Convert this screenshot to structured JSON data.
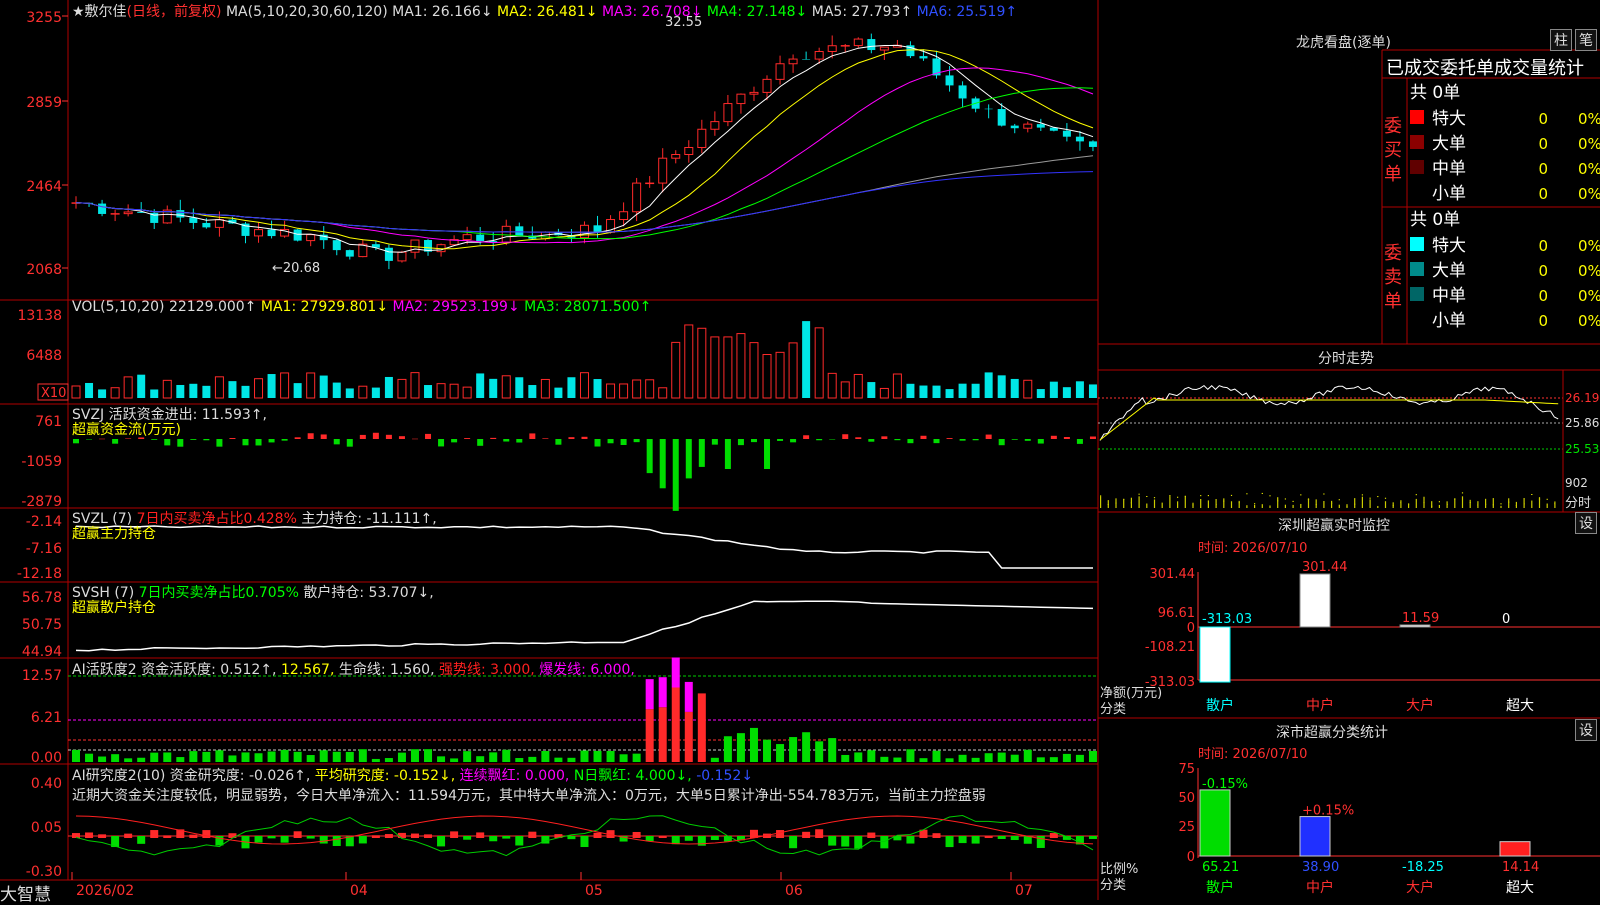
{
  "colors": {
    "up": "#ff2a2a",
    "down": "#00e6e6",
    "green": "#00dd00",
    "ma1": "#ffffff",
    "ma2": "#ffff00",
    "ma3": "#ff00ff",
    "ma4": "#00ff00",
    "ma5": "#9a9a9a",
    "ma6": "#3333ff",
    "grid": "#b00000"
  },
  "kline": {
    "title_stock": "★敷尔佳",
    "title_mode": "(日线，前复权)",
    "title_params": "MA(5,10,20,30,60,120)",
    "ma1": "MA1: 26.166↓",
    "ma2": "MA2: 26.481↓",
    "ma3": "MA3: 26.708↓",
    "ma4": "MA4: 27.148↓",
    "ma5": "MA5: 27.793↑",
    "ma6": "MA6: 25.519↑",
    "ticks": [
      "3255",
      "2859",
      "2464",
      "2068"
    ],
    "high_label": "32.55",
    "low_label": "←20.68"
  },
  "vol": {
    "title": "VOL(5,10,20)",
    "v": "22129.000↑",
    "ma1": "MA1: 27929.801↓",
    "ma2": "MA2: 29523.199↓",
    "ma3": "MA3: 28071.500↑",
    "ticks": [
      "13138",
      "6488"
    ],
    "unit": "X10"
  },
  "svzj": {
    "title": "SVZJ  活跃资金进出: 11.593↑,",
    "sub": "超赢资金流(万元)",
    "ticks": [
      "761",
      "-1059",
      "-2879"
    ]
  },
  "svzl": {
    "title": "SVZL (7)",
    "a": "7日内买卖净占比0.428%",
    "b": "主力持仓: -11.111↑,",
    "sub": "超赢主力持仓",
    "ticks": [
      "-2.14",
      "-7.16",
      "-12.18"
    ]
  },
  "svsh": {
    "title": "SVSH (7)",
    "a": "7日内买卖净占比0.705%",
    "b": "散户持仓: 53.707↓,",
    "sub": "超赢散户持仓",
    "ticks": [
      "56.78",
      "50.75",
      "44.94"
    ]
  },
  "aihy": {
    "t1": "AI活跃度2 资金活跃度: 0.512↑,",
    "t2": "12.567,",
    "t3": "生命线: 1.560,",
    "t4": "强势线: 3.000,",
    "t5": "爆发线: 6.000,",
    "ticks": [
      "12.57",
      "6.21",
      "0.00"
    ]
  },
  "aiyj": {
    "t1": "AI研究度2(10) 资金研究度: -0.026↑,",
    "t2": "平均研究度: -0.152↓,",
    "t3": "连续飘红: 0.000,",
    "t4": "N日飘红: 4.000↓,",
    "t5": "-0.152↓",
    "note": "近期大资金关注度较低，明显弱势，今日大单净流入：11.594万元，其中特大单净流入：0万元，大单5日累计净出-554.783万元，当前主力控盘弱",
    "ticks": [
      "0.40",
      "0.05",
      "-0.30"
    ]
  },
  "xaxis": {
    "labels": [
      "2026/02",
      "04",
      "05",
      "06",
      "07"
    ]
  },
  "brand": "大智慧",
  "right": {
    "lhb_title": "龙虎看盘(逐单)",
    "btn_zhu": "柱",
    "btn_bi": "笔",
    "order_title": "已成交委托单成交量统计",
    "buy": {
      "side": "委买单",
      "total": "共 0单",
      "rows": [
        {
          "name": "特大",
          "val": "0",
          "pct": "0%",
          "color": "#ff0000"
        },
        {
          "name": "大单",
          "val": "0",
          "pct": "0%",
          "color": "#8b0000"
        },
        {
          "name": "中单",
          "val": "0",
          "pct": "0%",
          "color": "#600000"
        },
        {
          "name": "小单",
          "val": "0",
          "pct": "0%",
          "color": ""
        }
      ]
    },
    "sell": {
      "side": "委卖单",
      "total": "共 0单",
      "rows": [
        {
          "name": "特大",
          "val": "0",
          "pct": "0%",
          "color": "#00ffff"
        },
        {
          "name": "大单",
          "val": "0",
          "pct": "0%",
          "color": "#008b8b"
        },
        {
          "name": "中单",
          "val": "0",
          "pct": "0%",
          "color": "#006666"
        },
        {
          "name": "小单",
          "val": "0",
          "pct": "0%",
          "color": ""
        }
      ]
    },
    "fs_title": "分时走势",
    "fs_ticks": [
      "26.19",
      "25.86",
      "25.53"
    ],
    "fs_vol": "902",
    "fs_unit": "分时",
    "sz_title": "深圳超赢实时监控",
    "sz_btn": "设",
    "sz_time": "时间: 2026/07/10",
    "sz_ticks": [
      "301.44",
      "96.61",
      "0",
      "-108.21",
      "-313.03"
    ],
    "sz_vals": [
      {
        "label": "-313.03",
        "v": -313.03
      },
      {
        "label": "301.44",
        "v": 301.44
      },
      {
        "label": "11.59",
        "v": 11.59
      },
      {
        "label": "0",
        "v": 0
      }
    ],
    "sz_ylab1": "净额(万元)",
    "sz_ylab2": "分类",
    "cats": [
      "散户",
      "中户",
      "大户",
      "超大"
    ],
    "ss_title": "深市超赢分类统计",
    "ss_btn": "设",
    "ss_time": "时间: 2026/07/10",
    "ss_ticks": [
      "75",
      "50",
      "25",
      "0"
    ],
    "ss_top": [
      "-0.15%",
      "+0.15%",
      "",
      ""
    ],
    "ss_vals": [
      {
        "label": "65.21",
        "v": 65.21
      },
      {
        "label": "38.90",
        "v": 38.9
      },
      {
        "label": "-18.25",
        "v": -18.25
      },
      {
        "label": "14.14",
        "v": 14.14
      }
    ],
    "ss_ylab1": "比例%",
    "ss_ylab2": "分类"
  }
}
